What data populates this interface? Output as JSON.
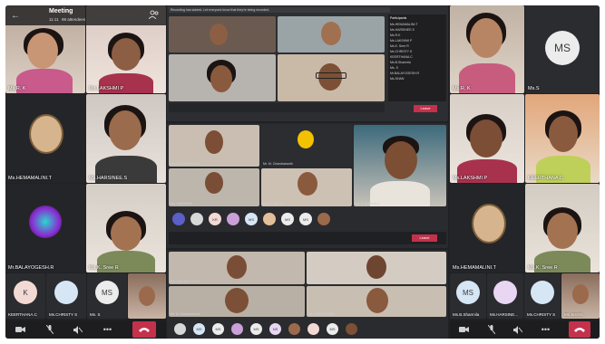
{
  "header": {
    "title": "Meeting",
    "time": "11:11",
    "attendees": "98 attendees",
    "back_icon": "arrow-left-icon",
    "participants_icon": "people-icon"
  },
  "participants": {
    "top_left_1": "Ms.R. K",
    "top_left_2": "Ms.LAKSHMI P",
    "hemamalini": "Ms.HEMAMALINI.T",
    "harsinee": "Ms.HARSINEE.S",
    "balayogesh": "Mr.BALAYOGESH.R",
    "k_sree": "Ms.K. Sree R",
    "top_right_1": "Ms.R. K",
    "top_right_2": "Ms.S",
    "ms_initials": "MS",
    "lakshmi_right": "Ms.LAKSHMI P",
    "keerthana_right": "KEERTHANA.C",
    "hemamalini_right": "Ms.HEMAMALINI.T",
    "sree_right": "Ms.K. Sree R"
  },
  "bottom_left_row": [
    {
      "initials": "K",
      "label": "KEERTHANA.C",
      "color": "#f3d9d4"
    },
    {
      "initials": "",
      "label": "Ms.CHRISTY S",
      "color": "#d6e6f5"
    },
    {
      "initials": "MS",
      "label": "Ms. S",
      "color": "#ececec"
    },
    {
      "initials": "",
      "label": "",
      "color": "#8a6d5c"
    }
  ],
  "bottom_right_row": [
    {
      "initials": "MS",
      "label": "Ms.B.Sharmila",
      "color": "#d6e6f5"
    },
    {
      "initials": "",
      "label": "Ms.HARSINE...",
      "color": "#e8d6f2"
    },
    {
      "initials": "",
      "label": "Ms.CHRISTY S",
      "color": "#d6e6f5"
    },
    {
      "initials": "",
      "label": "Ms.SHAN...",
      "color": "#8a6d5c"
    }
  ],
  "controls": {
    "camera_icon": "camera-icon",
    "mic_icon": "mic-off-icon",
    "speaker_icon": "speaker-off-icon",
    "more_icon": "more-icon",
    "hangup_icon": "hangup-icon",
    "more_label": "•••"
  },
  "inner_top": {
    "notice": "Recording has started. Let everyone know that they're being recorded.",
    "panel_title": "Participants",
    "leave": "Leave",
    "panel_rows": [
      "Ms.HEMAMALINI.T",
      "Ms.HARSINEE.S",
      "Ms.R.K",
      "Ms.LAKSHMI P",
      "Ms.K. Sree R",
      "Ms.CHRISTY S",
      "KEERTHANA.C",
      "Ms.B.Sharmila",
      "Ms. S",
      "Mr.BALAYOGESH.R",
      "Ms.SHAN"
    ]
  },
  "inner_middle": {
    "names": [
      "Ms.LAKSHMI PRIYA",
      "Mr. M. Chandrakanth",
      "Ms. HARSINEE",
      "Ms. K. Sree R",
      "Mr. K. Keerthana",
      "KEERTHANA.C"
    ],
    "avatar_row": [
      "",
      "",
      "KR",
      "",
      "MS",
      "",
      "MS",
      "MS",
      ""
    ],
    "leave": "Leave"
  },
  "inner_bottom": {
    "names": [
      "Ms.LAKSHMI PRIYA",
      "Ms.K.Sree R",
      "Mr. M. Chandrakanth",
      "Ms.R.SENTHAMIL"
    ],
    "avatar_row": [
      "",
      "MS",
      "MS",
      "",
      "MS",
      "NS",
      "",
      "",
      "MS",
      ""
    ]
  },
  "colors": {
    "frame_bg": "#202124",
    "hangup": "#c4314b",
    "accent": "#6264a7",
    "leave": "#c4314b"
  }
}
